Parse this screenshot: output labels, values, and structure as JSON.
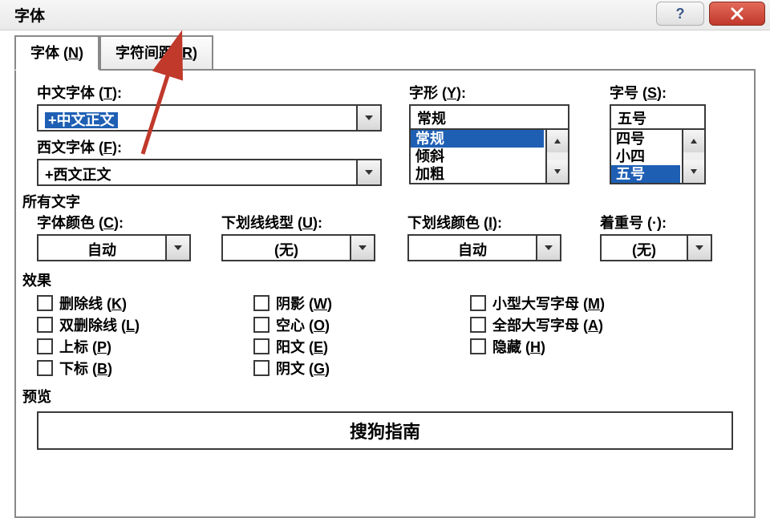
{
  "window": {
    "title": "字体"
  },
  "titlebar_buttons": {
    "help": "?",
    "close": "close"
  },
  "tabs": {
    "font": {
      "label_pre": "字体 (",
      "mn": "N",
      "label_post": ")"
    },
    "spacing": {
      "label_pre": "字符间距 (",
      "mn": "R",
      "label_post": ")"
    }
  },
  "labels": {
    "chinese_font": {
      "pre": "中文字体 (",
      "mn": "T",
      "post": "):"
    },
    "latin_font": {
      "pre": "西文字体 (",
      "mn": "F",
      "post": "):"
    },
    "style": {
      "pre": "字形 (",
      "mn": "Y",
      "post": "):"
    },
    "size": {
      "pre": "字号 (",
      "mn": "S",
      "post": "):"
    },
    "all_text": "所有文字",
    "font_color": {
      "pre": "字体颜色 (",
      "mn": "C",
      "post": "):"
    },
    "underline": {
      "pre": "下划线线型 (",
      "mn": "U",
      "post": "):"
    },
    "ul_color": {
      "pre": "下划线颜色 (",
      "mn": "I",
      "post": "):"
    },
    "emphasis": {
      "pre": "着重号 (·)",
      "post": ":"
    },
    "effects": "效果",
    "preview": "预览"
  },
  "fields": {
    "chinese_font_value": "+中文正文",
    "latin_font_value": "+西文正文",
    "style_value": "常规",
    "style_list": [
      "常规",
      "倾斜",
      "加粗"
    ],
    "size_value": "五号",
    "size_list": [
      "四号",
      "小四",
      "五号"
    ],
    "font_color_value": "自动",
    "underline_value": "(无)",
    "ul_color_value": "自动",
    "emphasis_value": "(无)"
  },
  "effects": {
    "col1": [
      {
        "pre": "删除线 (",
        "mn": "K",
        "post": ")"
      },
      {
        "pre": "双删除线 (",
        "mn": "L",
        "post": ")"
      },
      {
        "pre": "上标 (",
        "mn": "P",
        "post": ")"
      },
      {
        "pre": "下标 (",
        "mn": "B",
        "post": ")"
      }
    ],
    "col2": [
      {
        "pre": "阴影 (",
        "mn": "W",
        "post": ")"
      },
      {
        "pre": "空心 (",
        "mn": "O",
        "post": ")"
      },
      {
        "pre": "阳文 (",
        "mn": "E",
        "post": ")"
      },
      {
        "pre": "阴文 (",
        "mn": "G",
        "post": ")"
      }
    ],
    "col3": [
      {
        "pre": "小型大写字母 (",
        "mn": "M",
        "post": ")"
      },
      {
        "pre": "全部大写字母 (",
        "mn": "A",
        "post": ")"
      },
      {
        "pre": "隐藏 (",
        "mn": "H",
        "post": ")"
      }
    ]
  },
  "preview_text": "搜狗指南"
}
